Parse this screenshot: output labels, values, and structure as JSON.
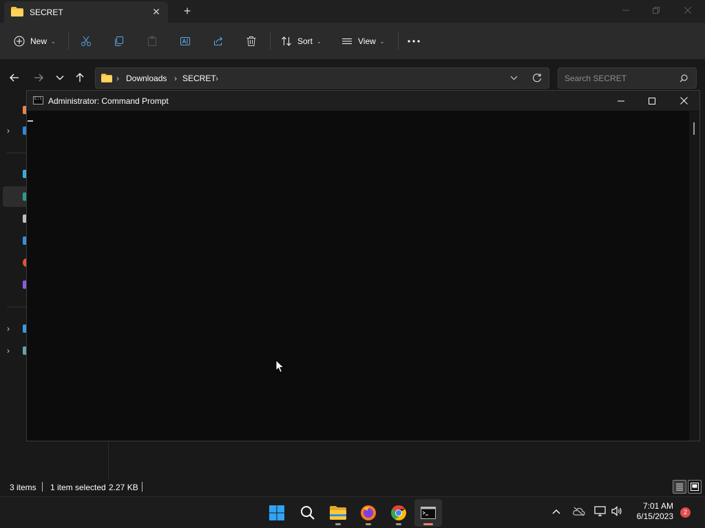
{
  "explorer": {
    "tab_title": "SECRET",
    "toolbar": {
      "new_label": "New",
      "sort_label": "Sort",
      "view_label": "View"
    },
    "breadcrumb": [
      "Downloads",
      "SECRET"
    ],
    "search_placeholder": "Search SECRET",
    "status": {
      "items": "3 items",
      "selection": "1 item selected",
      "size": "2.27 KB"
    }
  },
  "cmd": {
    "title": "Administrator:  Command Prompt",
    "icon_text": "C:\\"
  },
  "taskbar": {
    "time": "7:01 AM",
    "date": "6/15/2023",
    "notification_count": "2"
  },
  "colors": {
    "folder_yellow": "#f4c542",
    "cmd_background": "#0c0c0c",
    "windows_blue": "#2fa4f5",
    "active_indicator": "#f0836b",
    "badge_red": "#e24b4b"
  }
}
